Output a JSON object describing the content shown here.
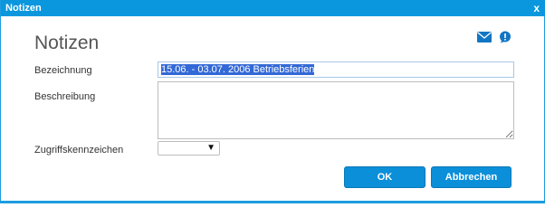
{
  "window": {
    "title": "Notizen",
    "close_glyph": "x"
  },
  "header": {
    "heading": "Notizen",
    "mail_icon": "mail-icon",
    "help_icon": "help-icon"
  },
  "form": {
    "bezeichnung_label": "Bezeichnung",
    "bezeichnung_value": "15.06. - 03.07. 2006 Betriebsferien",
    "beschreibung_label": "Beschreibung",
    "beschreibung_value": "",
    "zugriff_label": "Zugriffskennzeichen",
    "zugriff_value": "",
    "zugriff_arrow": "▼"
  },
  "buttons": {
    "ok_label": "OK",
    "cancel_label": "Abbrechen"
  },
  "colors": {
    "accent": "#0b97de",
    "button": "#0b8fd9",
    "selection": "#3369d6"
  }
}
